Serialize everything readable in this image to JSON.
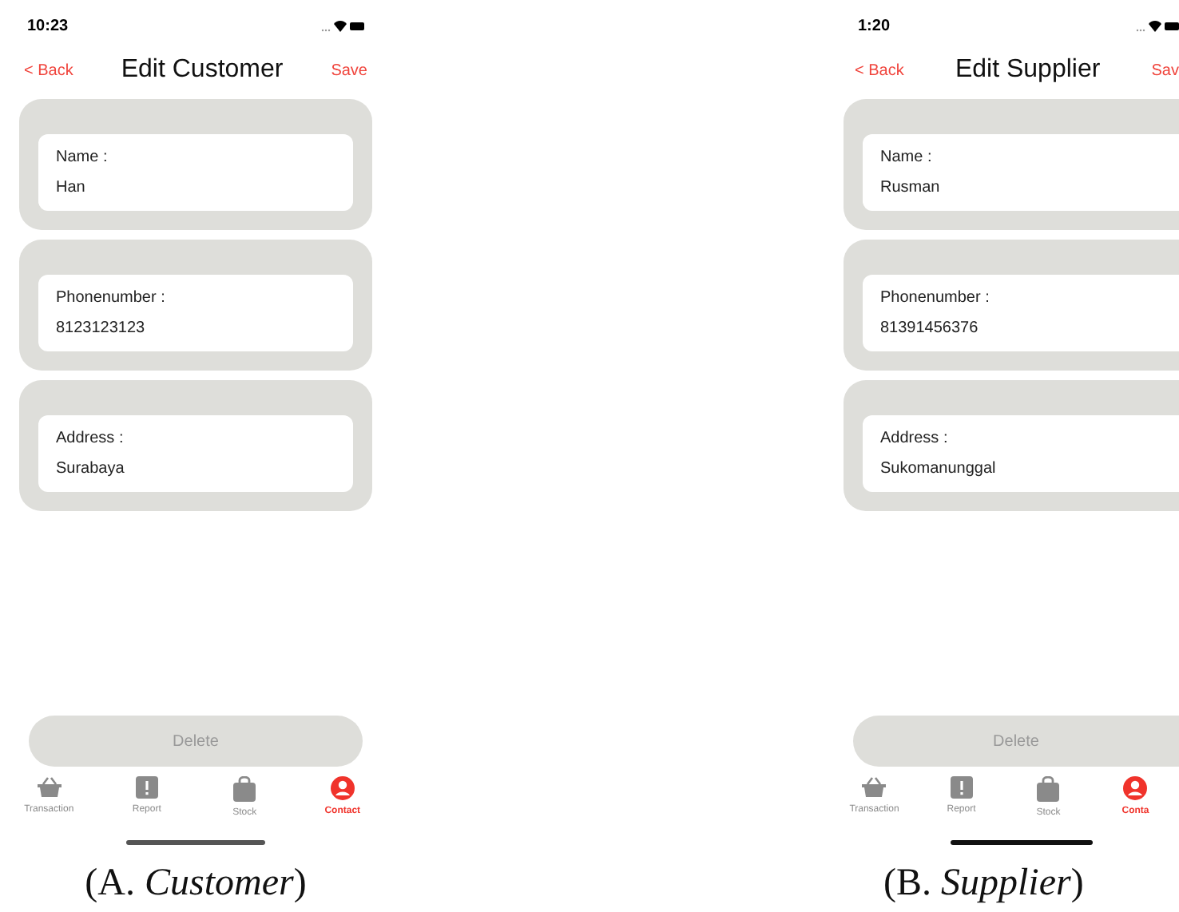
{
  "panels": [
    {
      "status_bar": {
        "time": "10:23"
      },
      "cut_off": false,
      "nav": {
        "back": "< Back",
        "title": "Edit Customer",
        "save": "Save"
      },
      "fields": [
        {
          "label": "Name :",
          "value": "Han"
        },
        {
          "label": "Phonenumber :",
          "value": "8123123123"
        },
        {
          "label": "Address :",
          "value": "Surabaya"
        }
      ],
      "delete_button": "Delete",
      "tabs": [
        {
          "label": "Transaction",
          "kind": "basket",
          "selected": false
        },
        {
          "label": "Report",
          "kind": "report",
          "selected": false
        },
        {
          "label": "Stock",
          "kind": "bag",
          "selected": false
        },
        {
          "label": "Contact",
          "kind": "person",
          "selected": true
        }
      ],
      "caption": {
        "letter": "(A. ",
        "word": "Customer",
        "close": ")"
      }
    },
    {
      "status_bar": {
        "time": "1:20"
      },
      "cut_off": true,
      "nav": {
        "back": "< Back",
        "title": "Edit Supplier",
        "save": "Sav"
      },
      "fields": [
        {
          "label": "Name :",
          "value": "Rusman"
        },
        {
          "label": "Phonenumber :",
          "value": "81391456376"
        },
        {
          "label": "Address :",
          "value": "Sukomanunggal"
        }
      ],
      "delete_button": "Delete",
      "tabs": [
        {
          "label": "Transaction",
          "kind": "basket",
          "selected": false
        },
        {
          "label": "Report",
          "kind": "report",
          "selected": false
        },
        {
          "label": "Stock",
          "kind": "bag",
          "selected": false
        },
        {
          "label": "Conta",
          "kind": "person",
          "selected": true
        }
      ],
      "caption": {
        "letter": "(B. ",
        "word": "Supplier",
        "close": ")"
      }
    }
  ]
}
